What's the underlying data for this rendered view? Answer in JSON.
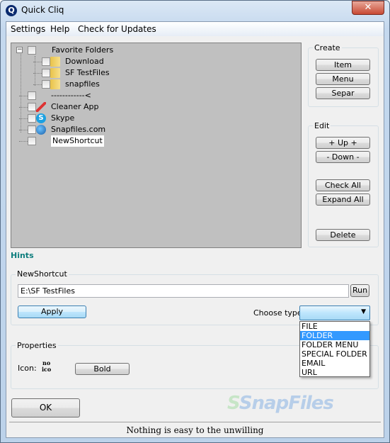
{
  "window": {
    "title": "Quick Cliq",
    "close": "✕"
  },
  "menu": [
    "Settings",
    "Help",
    "Check for Updates"
  ],
  "tree": [
    {
      "label": "Favorite Folders",
      "level": 0,
      "icon": "none",
      "expander": "⊟"
    },
    {
      "label": "Download",
      "level": 1,
      "icon": "folder-icon"
    },
    {
      "label": "SF TestFiles",
      "level": 1,
      "icon": "folder-icon"
    },
    {
      "label": "snapfiles",
      "level": 1,
      "icon": "folder-icon"
    },
    {
      "label": "------------<",
      "level": 0,
      "icon": "none"
    },
    {
      "label": "Cleaner App",
      "level": 0,
      "icon": "broom-icon"
    },
    {
      "label": "Skype",
      "level": 0,
      "icon": "skype-icon"
    },
    {
      "label": "Snapfiles.com",
      "level": 0,
      "icon": "globe-icon"
    },
    {
      "label": "NewShortcut",
      "level": 0,
      "icon": "none",
      "selected": true
    }
  ],
  "create": {
    "title": "Create",
    "buttons": [
      "Item",
      "Menu",
      "Separ"
    ]
  },
  "edit": {
    "title": "Edit",
    "buttons": [
      "+ Up +",
      "- Down -",
      "Check All",
      "Expand All",
      "Delete"
    ]
  },
  "hints": "Hints",
  "shortcut": {
    "title": "NewShortcut",
    "path": "E:\\SF TestFiles",
    "run": "Run",
    "apply": "Apply",
    "choose_type": "Choose type",
    "options": [
      "FILE",
      "FOLDER",
      "FOLDER MENU",
      "SPECIAL FOLDER",
      "EMAIL",
      "URL"
    ],
    "highlighted": "FOLDER"
  },
  "properties": {
    "title": "Properties",
    "icon_label": "Icon:",
    "no_icon_line1": "no",
    "no_icon_line2": "ico",
    "bold": "Bold"
  },
  "ok": "OK",
  "watermark": "SnapFiles",
  "status": "Nothing is easy to the unwilling",
  "colors": {
    "hints": "#0e7e7e",
    "tree_bg": "#c0c0c0",
    "selection": "#3399ff"
  }
}
